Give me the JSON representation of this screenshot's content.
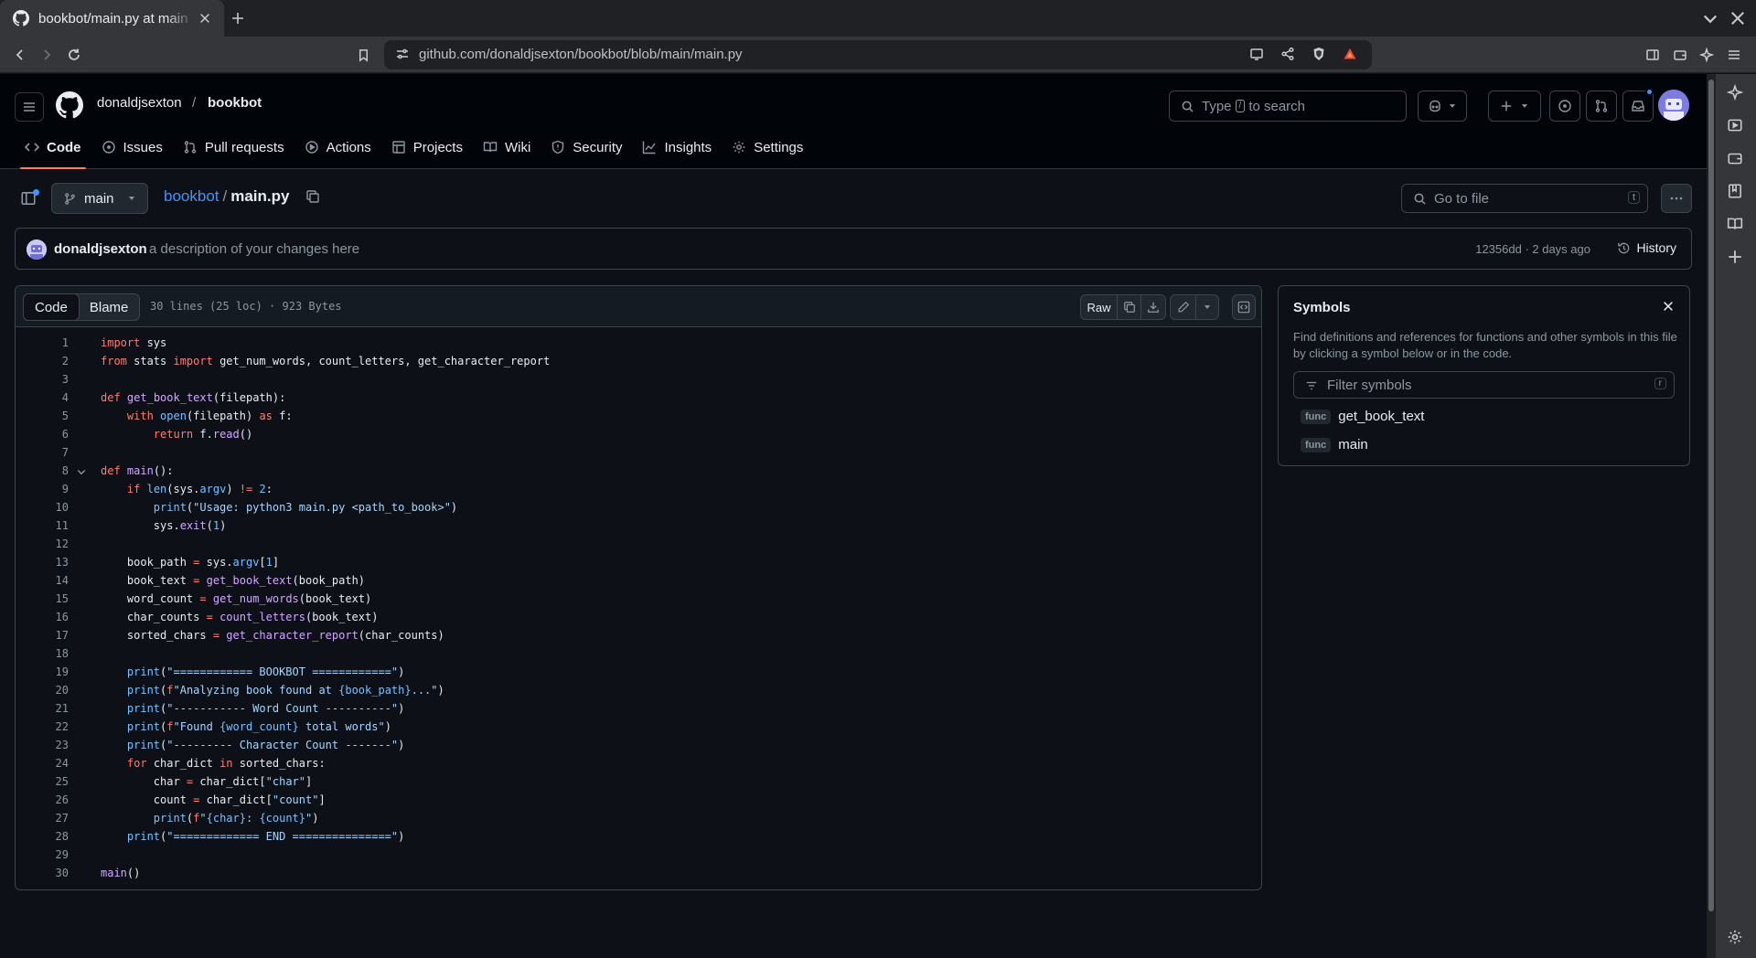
{
  "browser": {
    "tab_title": "bookbot/main.py at main · donaldjsexton/bookbot",
    "url": "github.com/donaldjsexton/bookbot/blob/main/main.py"
  },
  "header": {
    "owner": "donaldjsexton",
    "separator": "/",
    "repo": "bookbot",
    "search_placeholder_pre": "Type",
    "search_kbd": "/",
    "search_placeholder_post": "to search"
  },
  "repo_nav": [
    {
      "label": "Code",
      "icon": "code-icon",
      "active": true
    },
    {
      "label": "Issues",
      "icon": "issue-icon"
    },
    {
      "label": "Pull requests",
      "icon": "pull-request-icon"
    },
    {
      "label": "Actions",
      "icon": "play-icon"
    },
    {
      "label": "Projects",
      "icon": "table-icon"
    },
    {
      "label": "Wiki",
      "icon": "book-icon"
    },
    {
      "label": "Security",
      "icon": "shield-icon"
    },
    {
      "label": "Insights",
      "icon": "graph-icon"
    },
    {
      "label": "Settings",
      "icon": "gear-icon"
    }
  ],
  "file_header": {
    "branch": "main",
    "repo_link": "bookbot",
    "separator": "/",
    "file_name": "main.py",
    "goto_placeholder": "Go to file",
    "goto_kbd": "t"
  },
  "commit": {
    "author": "donaldjsexton",
    "message": "a description of your changes here",
    "meta": "12356dd · 2 days ago",
    "history_label": "History"
  },
  "code_view": {
    "tab_code": "Code",
    "tab_blame": "Blame",
    "file_info": "30 lines (25 loc) · 923 Bytes",
    "raw_label": "Raw"
  },
  "code_lines": [
    "1",
    "2",
    "3",
    "4",
    "5",
    "6",
    "7",
    "8",
    "9",
    "10",
    "11",
    "12",
    "13",
    "14",
    "15",
    "16",
    "17",
    "18",
    "19",
    "20",
    "21",
    "22",
    "23",
    "24",
    "25",
    "26",
    "27",
    "28",
    "29",
    "30"
  ],
  "symbols": {
    "title": "Symbols",
    "description": "Find definitions and references for functions and other symbols in this file by clicking a symbol below or in the code.",
    "filter_placeholder": "Filter symbols",
    "filter_kbd": "r",
    "items": [
      {
        "kind": "func",
        "name": "get_book_text"
      },
      {
        "kind": "func",
        "name": "main"
      }
    ]
  },
  "colors": {
    "background": "#0d1117",
    "header_background": "#010409",
    "border": "#3d444d",
    "link": "#4493f8",
    "active_tab_underline": "#f78166",
    "keyword": "#ff7b72",
    "function": "#d2a8ff",
    "string": "#a5d6ff",
    "number": "#79c0ff"
  }
}
